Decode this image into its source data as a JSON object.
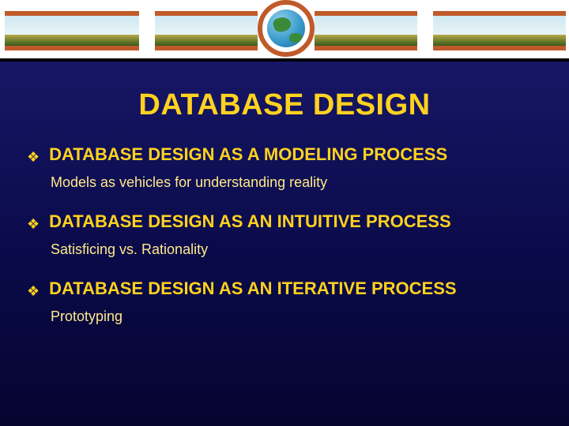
{
  "title": "DATABASE DESIGN",
  "items": [
    {
      "heading": "DATABASE DESIGN AS A MODELING PROCESS",
      "sub": "Models as vehicles for understanding reality"
    },
    {
      "heading": "DATABASE DESIGN AS AN INTUITIVE PROCESS",
      "sub": "Satisficing vs. Rationality"
    },
    {
      "heading": "DATABASE DESIGN AS AN ITERATIVE PROCESS",
      "sub": "Prototyping"
    }
  ],
  "bullet_glyph": "❖"
}
